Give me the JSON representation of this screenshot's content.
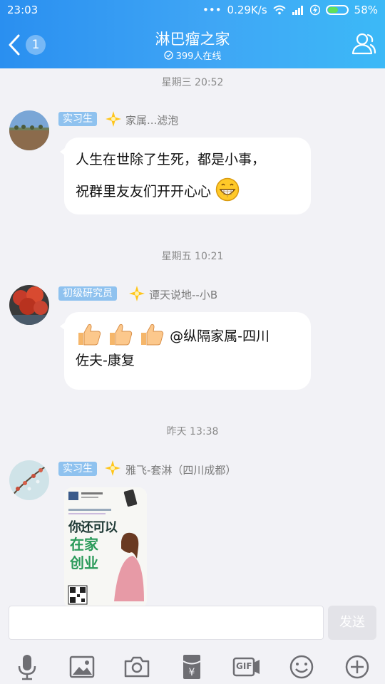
{
  "status": {
    "time": "23:03",
    "speed": "0.29K/s",
    "battery": "58%",
    "battery_level": 0.58
  },
  "header": {
    "back_count": "1",
    "title": "淋巴瘤之家",
    "online": "399人在线"
  },
  "messages": [
    {
      "timestamp": "星期三 20:52",
      "badge": "实习生",
      "nick": "家属...滤泡",
      "lines": [
        "人生在世除了生死，都是小事，",
        "祝群里友友们开开心心"
      ]
    },
    {
      "timestamp": "星期五 10:21",
      "badge": "初级研究员",
      "nick": "谭天说地--小B",
      "lines": [
        "@纵隔家属-四川",
        "佐夫-康复"
      ]
    },
    {
      "timestamp": "昨天 13:38",
      "badge": "实习生",
      "nick": "雅飞-套淋（四川成都）",
      "image": {
        "big_text": "你还可以",
        "line2": "在家",
        "line3": "创业"
      }
    }
  ],
  "input": {
    "placeholder": "",
    "send_label": "发送"
  },
  "toolbar": {
    "items": [
      "mic-icon",
      "picture-icon",
      "camera-icon",
      "red-packet-icon",
      "gif-icon",
      "emoji-icon",
      "plus-icon"
    ],
    "gif_label": "GIF"
  },
  "colors": {
    "header_start": "#2a8ff0",
    "header_end": "#3cb9f7",
    "badge": "#8fc2ef",
    "star": "#ffc51a"
  }
}
